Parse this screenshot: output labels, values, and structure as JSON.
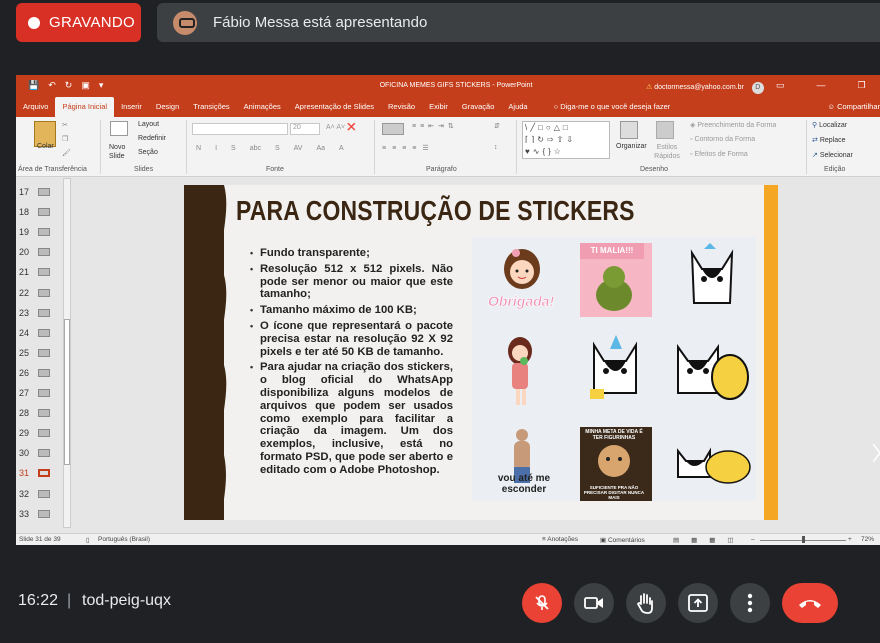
{
  "meet": {
    "recording_label": "GRAVANDO",
    "presenter_text": "Fábio Messa está apresentando",
    "time": "16:22",
    "separator": "|",
    "meeting_code": "tod-peig-uqx",
    "controls": [
      "mic-off-icon",
      "camera-icon",
      "raise-hand-icon",
      "present-icon",
      "more-icon",
      "end-call-icon"
    ],
    "colors": {
      "bg": "#202124",
      "record": "#d93025",
      "mic_off": "#ea4335",
      "end_call": "#ea4335"
    }
  },
  "ppt": {
    "window_title": "OFICINA MEMES GIFS STICKERS  -  PowerPoint",
    "user_email": "doctormessa@yahoo.com.br",
    "user_initial": "D",
    "tabs": [
      "Arquivo",
      "Página Inicial",
      "Inserir",
      "Design",
      "Transições",
      "Animações",
      "Apresentação de Slides",
      "Revisão",
      "Exibir",
      "Gravação",
      "Ajuda"
    ],
    "active_tab": "Página Inicial",
    "tell_me": "Diga-me o que você deseja fazer",
    "share": "Compartilhar",
    "ribbon": {
      "groups": [
        "Área de Transferência",
        "Slides",
        "Fonte",
        "Parágrafo",
        "Desenho",
        "Edição"
      ],
      "colar": "Colar",
      "novo_slide": "Novo Slide",
      "layout": "Layout",
      "redefinir": "Redefinir",
      "secao": "Seção",
      "font_size": "20",
      "font_btns": [
        "N",
        "I",
        "S",
        "abc",
        "S",
        "AV",
        "Aa",
        "A"
      ],
      "organizar": "Organizar",
      "estilos_rapidos": "Estilos Rápidos",
      "preenchimento": "Preenchimento da Forma",
      "contorno": "Contorno da Forma",
      "efeitos": "Efeitos de Forma",
      "localizar": "Localizar",
      "replace": "Replace",
      "selecionar": "Selecionar"
    },
    "slide_numbers": [
      "17",
      "18",
      "19",
      "20",
      "21",
      "22",
      "23",
      "24",
      "25",
      "26",
      "27",
      "28",
      "29",
      "30",
      "31",
      "32",
      "33"
    ],
    "selected_slide": "31",
    "status": {
      "slide_info": "Slide 31 de 39",
      "language": "Português (Brasil)",
      "notes": "Anotações",
      "comments": "Comentários",
      "zoom": "72%"
    }
  },
  "slide": {
    "title": "PARA CONSTRUÇÃO DE STICKERS",
    "bullets": [
      "Fundo transparente;",
      "Resolução 512 x 512 pixels. Não pode ser menor ou maior que este tamanho;",
      "Tamanho máximo de 100 KB;",
      "O ícone que representará o pacote precisa estar na resolução 92 X 92 pixels e ter até 50 KB de tamanho.",
      "Para ajudar na criação dos stickers, o blog oficial do WhatsApp disponibiliza alguns modelos de arquivos que podem ser usados como exemplo para facilitar a criação da imagem. Um dos exemplos, inclusive, está no formato PSD, que pode ser aberto e editado com o Adobe Photoshop."
    ],
    "sticker_texts": {
      "obrigada": "Obrigada!",
      "ti_malia": "TI MALIA!!!",
      "vou_ate": "vou até me esconder",
      "meta_top": "MINHA META DE VIDA É TER FIGURINHAS",
      "meta_bottom": "SUFICIENTE PRA NÃO PRECISAR DIGITAR NUNCA MAIS"
    },
    "colors": {
      "title": "#3a2612",
      "left_band": "#3a2612",
      "right_band": "#f5a623"
    }
  }
}
